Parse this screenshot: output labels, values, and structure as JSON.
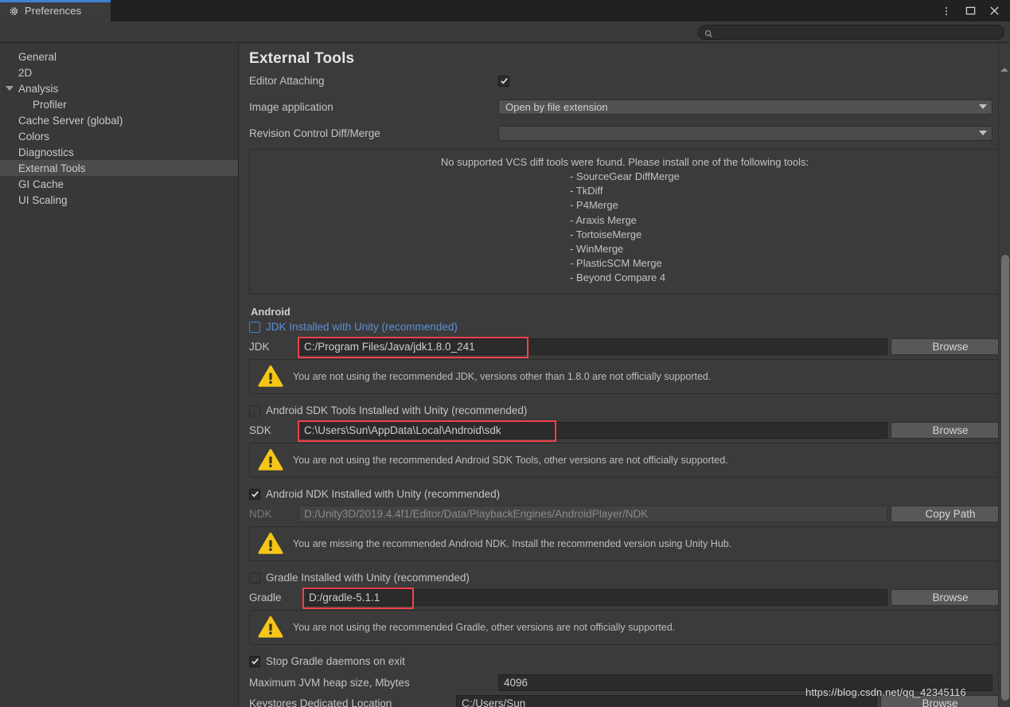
{
  "window": {
    "tab_label": "Preferences",
    "gear_icon": "gear-icon",
    "menu_icon": "kebab-menu-icon",
    "maximize_icon": "maximize-icon",
    "close_icon": "close-icon"
  },
  "search": {
    "value": "",
    "placeholder": "",
    "icon": "search-icon"
  },
  "sidebar": {
    "items": [
      {
        "label": "General",
        "indent": 0,
        "selected": false,
        "twisty": false
      },
      {
        "label": "2D",
        "indent": 0,
        "selected": false,
        "twisty": false
      },
      {
        "label": "Analysis",
        "indent": 0,
        "selected": false,
        "twisty": true
      },
      {
        "label": "Profiler",
        "indent": 1,
        "selected": false,
        "twisty": false
      },
      {
        "label": "Cache Server (global)",
        "indent": 0,
        "selected": false,
        "twisty": false
      },
      {
        "label": "Colors",
        "indent": 0,
        "selected": false,
        "twisty": false
      },
      {
        "label": "Diagnostics",
        "indent": 0,
        "selected": false,
        "twisty": false
      },
      {
        "label": "External Tools",
        "indent": 0,
        "selected": true,
        "twisty": false
      },
      {
        "label": "GI Cache",
        "indent": 0,
        "selected": false,
        "twisty": false
      },
      {
        "label": "UI Scaling",
        "indent": 0,
        "selected": false,
        "twisty": false
      }
    ]
  },
  "main": {
    "title": "External Tools",
    "editor_attaching": {
      "label": "Editor Attaching",
      "checked": true
    },
    "image_application": {
      "label": "Image application",
      "value": "Open by file extension"
    },
    "revision_control": {
      "label": "Revision Control Diff/Merge",
      "value": ""
    },
    "vcs_info": {
      "heading": "No supported VCS diff tools were found. Please install one of the following tools:",
      "tools": [
        "- SourceGear DiffMerge",
        "- TkDiff",
        "- P4Merge",
        "- Araxis Merge",
        "- TortoiseMerge",
        "- WinMerge",
        "- PlasticSCM Merge",
        "- Beyond Compare 4"
      ]
    },
    "android": {
      "section_title": "Android",
      "jdk": {
        "checkbox_label": "JDK Installed with Unity (recommended)",
        "checked": false,
        "field_label": "JDK",
        "path": "C:/Program Files/Java/jdk1.8.0_241",
        "button": "Browse",
        "warning": "You are not using the recommended JDK, versions other than 1.8.0 are not officially supported."
      },
      "sdk": {
        "checkbox_label": "Android SDK Tools Installed with Unity (recommended)",
        "checked": false,
        "field_label": "SDK",
        "path": "C:\\Users\\Sun\\AppData\\Local\\Android\\sdk",
        "button": "Browse",
        "warning": "You are not using the recommended Android SDK Tools, other versions are not officially supported."
      },
      "ndk": {
        "checkbox_label": "Android NDK Installed with Unity (recommended)",
        "checked": true,
        "field_label": "NDK",
        "path": "D:/Unity3D/2019.4.4f1/Editor/Data/PlaybackEngines/AndroidPlayer/NDK",
        "button": "Copy Path",
        "warning": "You are missing the recommended Android NDK. Install the recommended version using Unity Hub."
      },
      "gradle": {
        "checkbox_label": "Gradle Installed with Unity (recommended)",
        "checked": false,
        "field_label": "Gradle",
        "path": "D:/gradle-5.1.1",
        "button": "Browse",
        "warning": "You are not using the recommended Gradle, other versions are not officially supported."
      },
      "stop_daemons": {
        "label": "Stop Gradle daemons on exit",
        "checked": true
      },
      "jvm_heap": {
        "label": "Maximum JVM heap size, Mbytes",
        "value": "4096"
      },
      "keystores": {
        "label": "Keystores Dedicated Location",
        "value": "C:/Users/Sun",
        "button": "Browse"
      }
    }
  },
  "watermark": {
    "text": "https://blog.csdn.net/qq_42345116"
  },
  "colors": {
    "accent_blue": "#3e82d2",
    "link_blue": "#5a8fd6",
    "warning_yellow": "#f5c518",
    "highlight_red": "#f4414a",
    "panel_bg": "#3b3b3b",
    "sidebar_bg": "#383838",
    "titlebar_bg": "#212121",
    "selected_bg": "#4b4b4b"
  }
}
